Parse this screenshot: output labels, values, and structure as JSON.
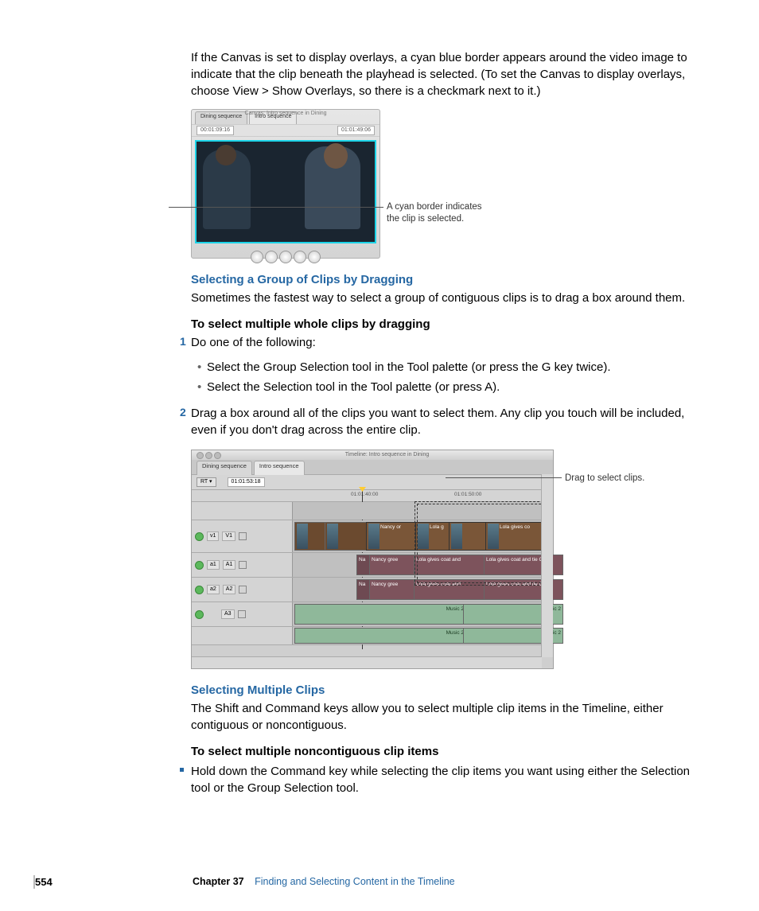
{
  "intro_para": "If the Canvas is set to display overlays, a cyan blue border appears around the video image to indicate that the clip beneath the playhead is selected. (To set the Canvas to display overlays, choose View > Show Overlays, so there is a checkmark next to it.)",
  "canvas": {
    "title": "Canvas: Intro sequence in Dining",
    "tab1": "Dining sequence",
    "tab2": "Intro sequence",
    "tc_left": "00:01:09:16",
    "tc_right": "01:01:49:06",
    "callout_l1": "A cyan border indicates",
    "callout_l2": "the clip is selected."
  },
  "h1": "Selecting a Group of Clips by Dragging",
  "p1": "Sometimes the fastest way to select a group of contiguous clips is to drag a box around them.",
  "h2": "To select multiple whole clips by dragging",
  "step1": {
    "num": "1",
    "text": "Do one of the following:"
  },
  "bullet1": "Select the Group Selection tool in the Tool palette (or press the G key twice).",
  "bullet2": "Select the Selection tool in the Tool palette (or press A).",
  "step2": {
    "num": "2",
    "text": "Drag a box around all of the clips you want to select them. Any clip you touch will be included, even if you don't drag across the entire clip."
  },
  "timeline": {
    "title": "Timeline: Intro sequence in Dining",
    "tab1": "Dining sequence",
    "tab2": "Intro sequence",
    "rt": "RT ▾",
    "tc": "01:01:53:18",
    "ruler1": "01:01:40:00",
    "ruler2": "01:01:50:00",
    "tracks": {
      "v1a": "v1",
      "v1b": "V1",
      "a1a": "a1",
      "a1b": "A1",
      "a2a": "a2",
      "a2b": "A2",
      "a3": "A3"
    },
    "clips": {
      "nancy_or": "Nancy or",
      "lola_g": "Lola g",
      "lola_gives_co": "Lola gives co",
      "na": "Na",
      "nancy_gree": "Nancy gree",
      "lola_coat_and": "Lola gives coat and",
      "lola_coat_tie": "Lola gives coat and tie CU",
      "music": "Music 2"
    },
    "callout": "Drag to select clips."
  },
  "h3": "Selecting Multiple Clips",
  "p3": "The Shift and Command keys allow you to select multiple clip items in the Timeline, either contiguous or noncontiguous.",
  "h4": "To select multiple noncontiguous clip items",
  "sq1": "Hold down the Command key while selecting the clip items you want using either the Selection tool or the Group Selection tool.",
  "footer": {
    "page": "554",
    "chapter": "Chapter 37",
    "title": "Finding and Selecting Content in the Timeline"
  }
}
